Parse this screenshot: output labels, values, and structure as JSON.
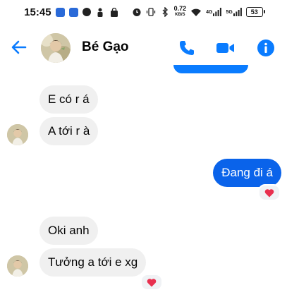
{
  "status_bar": {
    "time": "15:45",
    "network_speed_value": "0.72",
    "network_speed_unit": "KB/S",
    "signal_1_label": "4G",
    "signal_2_label": "5G",
    "battery": "53"
  },
  "header": {
    "contact_name": "Bé Gạo",
    "icons": [
      "back-arrow-icon",
      "phone-icon",
      "video-camera-icon",
      "info-icon"
    ],
    "accent_color": "#0a7cff"
  },
  "messages": [
    {
      "sender": "contact",
      "text": "E có r á"
    },
    {
      "sender": "contact",
      "text": "A tới r à"
    },
    {
      "sender": "me",
      "text": "Đang đi á",
      "reaction": "heart"
    },
    {
      "sender": "contact",
      "text": "Oki anh"
    },
    {
      "sender": "contact",
      "text": "Tưởng a tới e xg",
      "reaction": "heart"
    }
  ],
  "colors": {
    "outgoing_bubble": "#0a63ea",
    "incoming_bubble": "#f0f0f0",
    "reaction_heart": "#e8304f"
  }
}
